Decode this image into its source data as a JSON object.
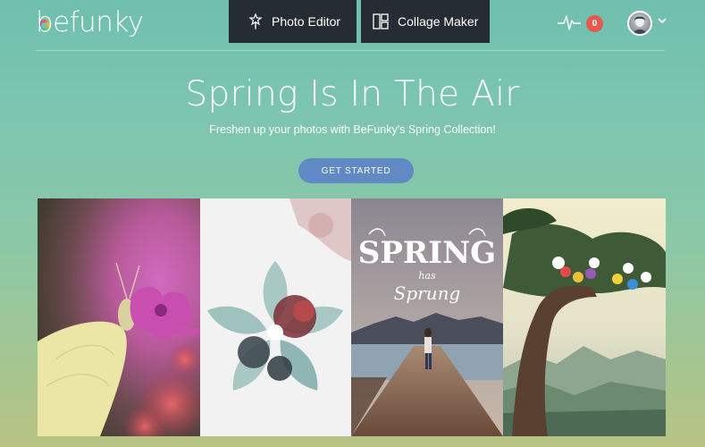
{
  "header": {
    "logo_text": "befunky",
    "nav": [
      {
        "label": "Photo Editor",
        "icon": "magic-wand-icon"
      },
      {
        "label": "Collage Maker",
        "icon": "collage-grid-icon"
      }
    ],
    "notifications_count": "0",
    "activity_icon": "pulse-icon",
    "avatar_icon": "user-avatar"
  },
  "hero": {
    "title": "Spring Is In The Air",
    "subtitle": "Freshen up your photos with BeFunky's Spring Collection!",
    "cta_label": "GET STARTED"
  },
  "gallery": {
    "panels": [
      {
        "subject": "butterfly-on-pink-flower"
      },
      {
        "subject": "flower-shape-overlay"
      },
      {
        "subject": "person-on-road-with-text",
        "overlay_lines": [
          "SPRING",
          "has",
          "Sprung"
        ]
      },
      {
        "subject": "tree-with-birds"
      }
    ]
  },
  "colors": {
    "nav_bg": "#262c33",
    "cta_bg": "#6189c4",
    "badge_bg": "#e8594d"
  }
}
